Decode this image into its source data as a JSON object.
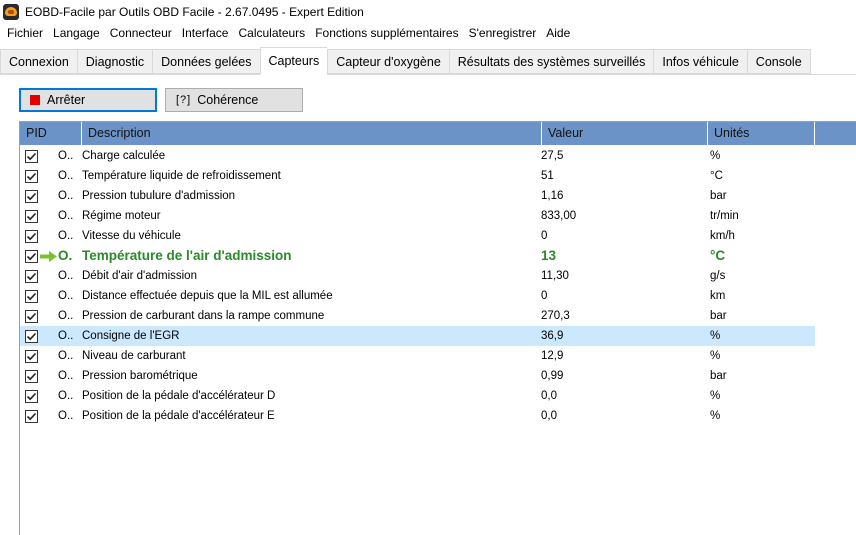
{
  "window": {
    "title": "EOBD-Facile par Outils OBD Facile - 2.67.0495 - Expert Edition",
    "icon": "car-icon"
  },
  "menu": [
    "Fichier",
    "Langage",
    "Connecteur",
    "Interface",
    "Calculateurs",
    "Fonctions supplémentaires",
    "S'enregistrer",
    "Aide"
  ],
  "tabs": [
    {
      "label": "Connexion"
    },
    {
      "label": "Diagnostic"
    },
    {
      "label": "Données gelées"
    },
    {
      "label": "Capteurs",
      "active": true
    },
    {
      "label": "Capteur d'oxygène"
    },
    {
      "label": "Résultats des systèmes surveillés"
    },
    {
      "label": "Infos véhicule"
    },
    {
      "label": "Console"
    }
  ],
  "toolbar": {
    "stop_label": "Arrêter",
    "stop_icon": "stop-icon",
    "stop_color": "#e00000",
    "check_label": "Cohérence",
    "check_icon": "[?]"
  },
  "grid": {
    "header_color": "#6b93c8",
    "columns": [
      "PID",
      "Description",
      "Valeur",
      "Unités"
    ],
    "rows": [
      {
        "pid": "O..",
        "description": "Charge calculée",
        "value": "27,5",
        "unit": "%"
      },
      {
        "pid": "O..",
        "description": "Température liquide de refroidissement",
        "value": "51",
        "unit": "°C"
      },
      {
        "pid": "O..",
        "description": "Pression tubulure d'admission",
        "value": "1,16",
        "unit": "bar"
      },
      {
        "pid": "O..",
        "description": "Régime moteur",
        "value": "833,00",
        "unit": "tr/min"
      },
      {
        "pid": "O..",
        "description": "Vitesse du véhicule",
        "value": "0",
        "unit": "km/h"
      },
      {
        "pid": "O.",
        "description": "Température de l'air d'admission",
        "value": "13",
        "unit": "°C",
        "highlight": true
      },
      {
        "pid": "O..",
        "description": "Débit d'air d'admission",
        "value": "11,30",
        "unit": "g/s"
      },
      {
        "pid": "O..",
        "description": "Distance effectuée depuis que la MIL est allumée",
        "value": "0",
        "unit": "km"
      },
      {
        "pid": "O..",
        "description": "Pression de carburant dans la rampe commune",
        "value": "270,3",
        "unit": "bar"
      },
      {
        "pid": "O..",
        "description": "Consigne de l'EGR",
        "value": "36,9",
        "unit": "%",
        "selected": true
      },
      {
        "pid": "O..",
        "description": "Niveau de carburant",
        "value": "12,9",
        "unit": "%"
      },
      {
        "pid": "O..",
        "description": "Pression barométrique",
        "value": "0,99",
        "unit": "bar"
      },
      {
        "pid": "O..",
        "description": "Position de la pédale d'accélérateur D",
        "value": "0,0",
        "unit": "%"
      },
      {
        "pid": "O..",
        "description": "Position de la pédale d'accélérateur E",
        "value": "0,0",
        "unit": "%"
      }
    ],
    "highlight_color": "#2a8a2a",
    "selected_color": "#cce8ff"
  }
}
